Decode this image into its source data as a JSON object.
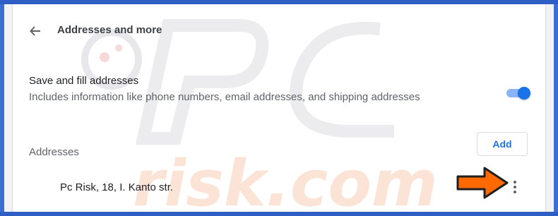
{
  "header": {
    "title": "Addresses and more",
    "back_icon": "arrow-left-icon"
  },
  "save_fill": {
    "title": "Save and fill addresses",
    "description": "Includes information like phone numbers, email addresses, and shipping addresses",
    "enabled": true
  },
  "addresses": {
    "section_label": "Addresses",
    "add_label": "Add",
    "items": [
      {
        "text": "Pc Risk, 18, I. Kanto str."
      }
    ],
    "more_icon": "more-vertical-icon"
  },
  "annotation": {
    "icon": "orange-arrow-icon",
    "color": "#ff6a00"
  },
  "colors": {
    "frame": "#3c6fd1",
    "accent": "#1a73e8",
    "toggle_track": "#8ab4f8"
  }
}
